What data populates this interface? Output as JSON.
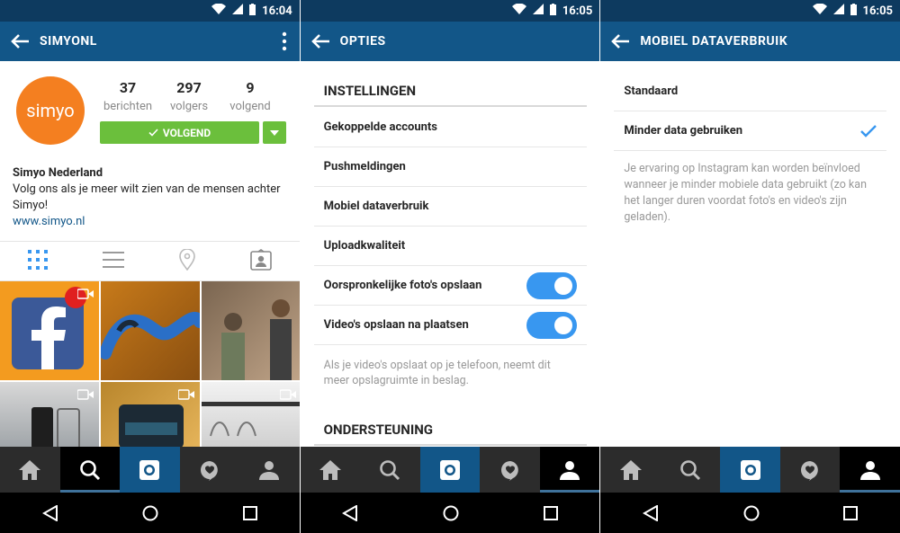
{
  "status": {
    "time_1": "16:04",
    "time_2": "16:05",
    "time_3": "16:05"
  },
  "profile": {
    "title": "SIMYONL",
    "avatar_text": "simyo",
    "stats": [
      {
        "num": "37",
        "label": "berichten"
      },
      {
        "num": "297",
        "label": "volgers"
      },
      {
        "num": "9",
        "label": "volgend"
      }
    ],
    "follow_label": "VOLGEND",
    "name": "Simyo Nederland",
    "bio": "Volg ons als je meer wilt zien van de mensen achter Simyo!",
    "link": "www.simyo.nl"
  },
  "options": {
    "title": "OPTIES",
    "section_settings": "INSTELLINGEN",
    "items": [
      {
        "label": "Gekoppelde accounts"
      },
      {
        "label": "Pushmeldingen"
      },
      {
        "label": "Mobiel dataverbruik"
      },
      {
        "label": "Uploadkwaliteit"
      },
      {
        "label": "Oorspronkelijke foto's opslaan",
        "toggle": true
      },
      {
        "label": "Video's opslaan na plaatsen",
        "toggle": true
      }
    ],
    "help": "Als je video's opslaat op je telefoon, neemt dit meer opslagruimte in beslag.",
    "section_support": "ONDERSTEUNING"
  },
  "data_usage": {
    "title": "MOBIEL DATAVERBRUIK",
    "option_standard": "Standaard",
    "option_less": "Minder data gebruiken",
    "description": "Je ervaring op Instagram kan worden beïnvloed wanneer je minder mobiele data gebruikt (zo kan het langer duren voordat foto's en video's zijn geladen)."
  },
  "colors": {
    "appbar": "#125688",
    "statusbar": "#0d3a5f",
    "follow_green": "#6bbf3c",
    "toggle_blue": "#3897f0",
    "check_blue": "#3897f0"
  }
}
